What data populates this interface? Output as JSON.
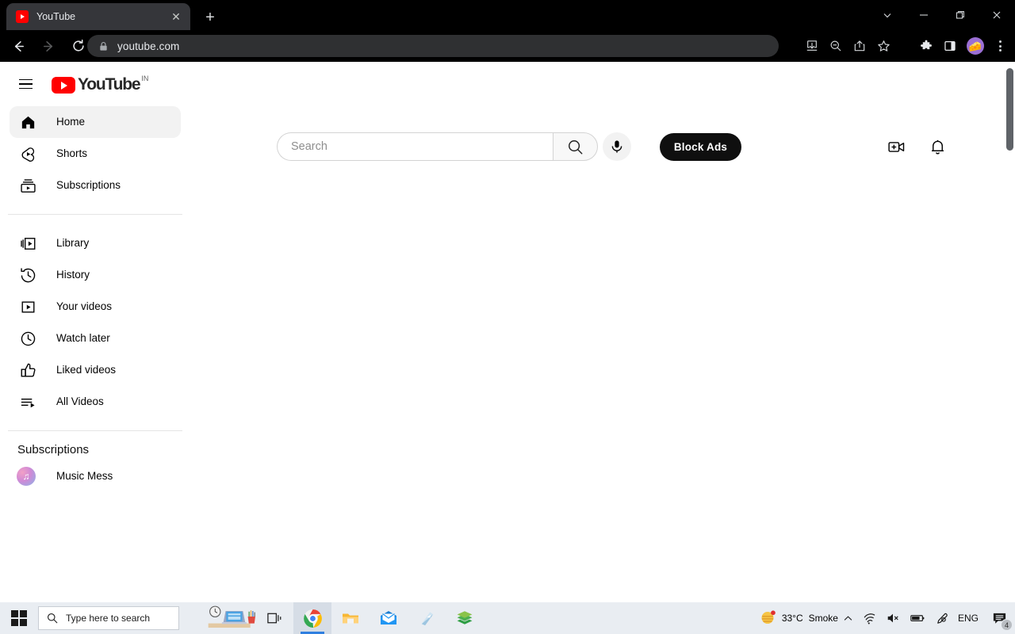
{
  "browser": {
    "tab": {
      "title": "YouTube",
      "favicon": "youtube-play-icon",
      "close": "✕"
    },
    "new_tab_label": "+",
    "window_controls": [
      {
        "name": "tab-search",
        "glyph": "⌄"
      },
      {
        "name": "minimize",
        "glyph": "—"
      },
      {
        "name": "maximize-restore",
        "glyph": "❐"
      },
      {
        "name": "close",
        "glyph": "✕"
      }
    ],
    "nav": {
      "back": "back-arrow-icon",
      "forward": "forward-arrow-icon",
      "reload": "reload-icon"
    },
    "omnibox": {
      "url": "youtube.com",
      "lock": "lock-icon"
    },
    "omnibox_icons": [
      "install-icon",
      "zoom-out-icon",
      "share-icon",
      "bookmark-star-icon"
    ],
    "toolbar_icons": [
      "extensions-puzzle-icon",
      "side-panel-icon"
    ],
    "avatar_emoji": "🧀",
    "menu": "three-dot-menu-icon"
  },
  "youtube": {
    "logo": {
      "word": "YouTube",
      "country_code": "IN"
    },
    "search": {
      "placeholder": "Search",
      "button_icon": "search-icon"
    },
    "mic_label": "microphone-icon",
    "block_ads_label": "Block Ads",
    "header_right": [
      {
        "name": "create-video-icon",
        "label": "Create"
      },
      {
        "name": "notifications-bell-icon",
        "label": "Notifications"
      }
    ],
    "sidebar": {
      "primary": [
        {
          "label": "Home",
          "icon": "home-icon",
          "active": true
        },
        {
          "label": "Shorts",
          "icon": "shorts-icon",
          "active": false
        },
        {
          "label": "Subscriptions",
          "icon": "subscriptions-icon",
          "active": false
        }
      ],
      "library": [
        {
          "label": "Library",
          "icon": "library-icon"
        },
        {
          "label": "History",
          "icon": "history-icon"
        },
        {
          "label": "Your videos",
          "icon": "your-videos-icon"
        },
        {
          "label": "Watch later",
          "icon": "watch-later-clock-icon"
        },
        {
          "label": "Liked videos",
          "icon": "thumbs-up-icon"
        },
        {
          "label": "All Videos",
          "icon": "playlist-icon"
        }
      ],
      "subscriptions_title": "Subscriptions",
      "subscriptions": [
        {
          "label": "Music Mess",
          "avatar": "music-note-avatar"
        }
      ]
    }
  },
  "taskbar": {
    "start": "windows-start-icon",
    "search_placeholder": "Type here to search",
    "apps": [
      {
        "name": "task-view-icon",
        "label": "Task View",
        "active": false
      },
      {
        "name": "chrome-icon",
        "label": "Google Chrome",
        "active": true
      },
      {
        "name": "file-explorer-icon",
        "label": "File Explorer",
        "active": false
      },
      {
        "name": "mail-icon",
        "label": "Mail",
        "active": false
      },
      {
        "name": "store-icon",
        "label": "Microsoft Store",
        "active": false
      },
      {
        "name": "bluestacks-icon",
        "label": "BlueStacks",
        "active": false
      }
    ],
    "tray": {
      "weather_temp": "33°C",
      "weather_condition": "Smoke",
      "show_hidden": "⌃",
      "network": "wifi-icon",
      "volume": "speaker-muted-icon",
      "battery": "battery-icon",
      "pen": "pen-icon",
      "language": "ENG",
      "notifications_count": "4"
    }
  },
  "colors": {
    "brand_red": "#ff0000",
    "chrome_dark": "#000000",
    "omnibox_bg": "#2f3032",
    "active_nav_bg": "#f2f2f2",
    "block_ads_bg": "#0f0f0f",
    "taskbar_bg": "#e9edf2",
    "accent_blue": "#2f7fe0"
  }
}
